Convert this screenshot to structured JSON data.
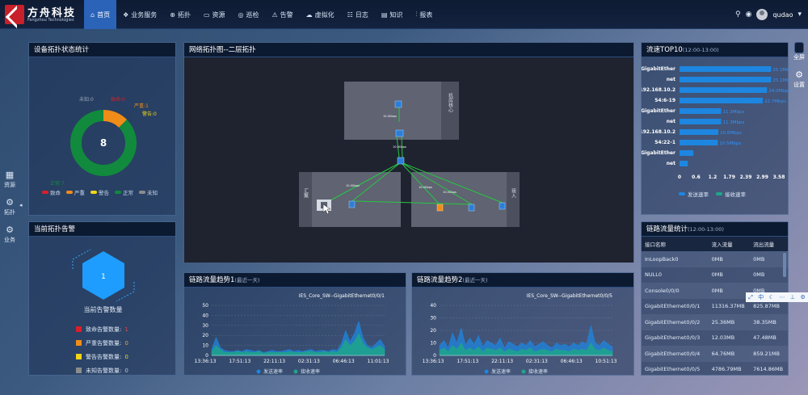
{
  "brand": {
    "name_cn": "方舟科技",
    "name_en": "Fangzhou Technologies"
  },
  "nav": [
    {
      "label": "首页",
      "icon": "home-icon",
      "glyph": "⌂"
    },
    {
      "label": "业务服务",
      "icon": "cubes-icon",
      "glyph": "❖"
    },
    {
      "label": "拓扑",
      "icon": "globe-icon",
      "glyph": "⊕"
    },
    {
      "label": "资源",
      "icon": "monitor-icon",
      "glyph": "▭"
    },
    {
      "label": "巡检",
      "icon": "inspect-icon",
      "glyph": "◎"
    },
    {
      "label": "告警",
      "icon": "alarm-icon",
      "glyph": "⚠"
    },
    {
      "label": "虚拟化",
      "icon": "cloud-icon",
      "glyph": "☁"
    },
    {
      "label": "日志",
      "icon": "log-icon",
      "glyph": "☷"
    },
    {
      "label": "知识",
      "icon": "book-icon",
      "glyph": "▤"
    },
    {
      "label": "报表",
      "icon": "chart-icon",
      "glyph": "⫶"
    }
  ],
  "user": {
    "name": "qudao"
  },
  "left_rail": [
    {
      "label": "资源",
      "glyph": "▦"
    },
    {
      "label": "拓扑",
      "glyph": "⚙"
    },
    {
      "label": "业务",
      "glyph": "⚙"
    }
  ],
  "right_rail": [
    {
      "label": "全屏"
    },
    {
      "label": "设置",
      "glyph": "⚙"
    }
  ],
  "device_status": {
    "title": "设备拓扑状态统计",
    "center_value": "8",
    "labels": {
      "unknown": "未知:0",
      "critical": "致命:0",
      "severe": "严重:1",
      "warning": "警告:0",
      "normal": "正常:7"
    },
    "legend": [
      {
        "label": "致命",
        "color": "#d8202a"
      },
      {
        "label": "严重",
        "color": "#f08c18"
      },
      {
        "label": "警告",
        "color": "#f2d418"
      },
      {
        "label": "正常",
        "color": "#118a3d"
      },
      {
        "label": "未知",
        "color": "#8c8c8c"
      }
    ],
    "counts": {
      "critical": 0,
      "severe": 1,
      "warning": 0,
      "normal": 7,
      "unknown": 0
    }
  },
  "current_alarms": {
    "title": "当前拓扑告警",
    "total": "1",
    "caption": "当前告警数量",
    "items": [
      {
        "label": "致命告警数量:",
        "value": "1",
        "color": "#d8202a",
        "value_color": "#e24a4a"
      },
      {
        "label": "严重告警数量:",
        "value": "0",
        "color": "#f08c18",
        "value_color": "#f0a03a"
      },
      {
        "label": "警告告警数量:",
        "value": "0",
        "color": "#f2d418",
        "value_color": "#f2d418"
      },
      {
        "label": "未知告警数量:",
        "value": "0",
        "color": "#8c8c8c",
        "value_color": "#c0c6cf"
      }
    ]
  },
  "topology": {
    "title": "网络拓扑图--二层拓扑",
    "groups": [
      {
        "label": "机房核心"
      },
      {
        "label": "汇聚"
      },
      {
        "label": "接入"
      }
    ]
  },
  "top10": {
    "title": "流速TOP10",
    "subtitle": "(12:00-13:00)",
    "rows": [
      {
        "label": "GigabitEther",
        "value_label": "25.1Mb"
      },
      {
        "label": "net",
        "value_label": "25.1Mb"
      },
      {
        "label": "192.168.10.2",
        "value_label": "24.0Mbps"
      },
      {
        "label": "54:6-19",
        "value_label": "22.7Mbps"
      },
      {
        "label": "GigabitEther",
        "value_label": "11.3Mbps"
      },
      {
        "label": "net",
        "value_label": "11.3Mbps"
      },
      {
        "label": "192.168.10.2",
        "value_label": "10.6Mbps"
      },
      {
        "label": "54:22-1",
        "value_label": "10.5Mbps"
      },
      {
        "label": "GigabitEther",
        "value_label": ""
      },
      {
        "label": "net",
        "value_label": ""
      }
    ],
    "bar_values": [
      3.3,
      3.3,
      3.15,
      3.0,
      1.5,
      1.5,
      1.4,
      1.38,
      0.5,
      0.3
    ],
    "axis_ticks": [
      "0",
      "0.6",
      "1.2",
      "1.79",
      "2.39",
      "2.99",
      "3.58"
    ],
    "legend": [
      "发送速率",
      "接收速率"
    ]
  },
  "link_stats": {
    "title": "链路流量统计",
    "subtitle": "(12:00-13:00)",
    "columns": [
      "接口名称",
      "流入流量",
      "流出流量"
    ],
    "rows": [
      [
        "InLoopBack0",
        "0MB",
        "0MB"
      ],
      [
        "NULL0",
        "0MB",
        "0MB"
      ],
      [
        "Console0/0/0",
        "0MB",
        "0MB"
      ],
      [
        "GigabitEthernet0/0/1",
        "11316.37MB",
        "825.87MB"
      ],
      [
        "GigabitEthernet0/0/2",
        "25.36MB",
        "38.35MB"
      ],
      [
        "GigabitEthernet0/0/3",
        "12.03MB",
        "47.48MB"
      ],
      [
        "GigabitEthernet0/0/4",
        "64.76MB",
        "859.21MB"
      ],
      [
        "GigabitEthernet0/0/5",
        "4786.79MB",
        "7614.86MB"
      ]
    ]
  },
  "float_tools": [
    "⤢",
    "中",
    "☾",
    "⋯",
    "⊥",
    "⚙"
  ],
  "trend1": {
    "title": "链路流量趋势1",
    "subtitle": "(最近一天)",
    "series_title": "IES_Core_SW--GigabitEthernet0/0/1",
    "yticks": [
      "50",
      "40",
      "30",
      "20",
      "10",
      "0"
    ],
    "xticks": [
      "13:36:13",
      "17:51:13",
      "22:11:13",
      "02:31:13",
      "06:46:13",
      "11:01:13"
    ],
    "legend": [
      "发送速率",
      "接收速率"
    ]
  },
  "trend2": {
    "title": "链路流量趋势2",
    "subtitle": "(最近一天)",
    "series_title": "IES_Core_SW--GigabitEthernet0/0/5",
    "yticks": [
      "40",
      "30",
      "20",
      "10",
      "0"
    ],
    "xticks": [
      "13:36:13",
      "17:51:13",
      "22:11:13",
      "02:31:13",
      "06:46:13",
      "10:51:13"
    ],
    "legend": [
      "发送速率",
      "接收速率"
    ]
  },
  "chart_data": [
    {
      "type": "pie",
      "title": "设备拓扑状态统计",
      "categories": [
        "致命",
        "严重",
        "警告",
        "正常",
        "未知"
      ],
      "values": [
        0,
        1,
        0,
        7,
        0
      ]
    },
    {
      "type": "bar",
      "title": "流速TOP10",
      "categories": [
        "GigabitEther",
        "net",
        "192.168.10.2",
        "54:6-19",
        "GigabitEther",
        "net",
        "192.168.10.2",
        "54:22-1",
        "GigabitEther",
        "net"
      ],
      "values": [
        3.3,
        3.3,
        3.15,
        3.0,
        1.5,
        1.5,
        1.4,
        1.38,
        0.5,
        0.3
      ],
      "xlim": [
        0,
        3.58
      ]
    },
    {
      "type": "area",
      "title": "链路流量趋势1",
      "ylim": [
        0,
        50
      ],
      "x": [
        "13:36:13",
        "17:51:13",
        "22:11:13",
        "02:31:13",
        "06:46:13",
        "11:01:13"
      ],
      "series": [
        {
          "name": "发送速率",
          "values": [
            6,
            18,
            8,
            5,
            4,
            4,
            5,
            4,
            6,
            5,
            4,
            5,
            3,
            4,
            5,
            4,
            4,
            5,
            6,
            4,
            5,
            4,
            5,
            6,
            4,
            5,
            5,
            4,
            6,
            5,
            12,
            25,
            14,
            22,
            34,
            18,
            10,
            8,
            12,
            16,
            9
          ]
        },
        {
          "name": "接收速率",
          "values": [
            4,
            10,
            6,
            3,
            3,
            3,
            4,
            3,
            4,
            3,
            3,
            4,
            2,
            3,
            3,
            3,
            3,
            3,
            4,
            3,
            3,
            3,
            4,
            4,
            3,
            3,
            4,
            3,
            4,
            3,
            8,
            16,
            10,
            14,
            22,
            12,
            8,
            6,
            8,
            10,
            6
          ]
        }
      ]
    },
    {
      "type": "area",
      "title": "链路流量趋势2",
      "ylim": [
        0,
        40
      ],
      "x": [
        "13:36:13",
        "17:51:13",
        "22:11:13",
        "02:31:13",
        "06:46:13",
        "10:51:13"
      ],
      "series": [
        {
          "name": "发送速率",
          "values": [
            8,
            12,
            6,
            18,
            10,
            22,
            8,
            14,
            9,
            16,
            7,
            12,
            10,
            8,
            14,
            6,
            11,
            9,
            7,
            10,
            8,
            12,
            7,
            9,
            11,
            8,
            6,
            10,
            8,
            9,
            7,
            10,
            8,
            11,
            9,
            24,
            10,
            8,
            12,
            9,
            7
          ]
        },
        {
          "name": "接收速率",
          "values": [
            4,
            6,
            3,
            8,
            5,
            10,
            4,
            6,
            4,
            7,
            3,
            6,
            5,
            4,
            6,
            3,
            5,
            4,
            3,
            5,
            4,
            6,
            3,
            4,
            5,
            4,
            3,
            5,
            4,
            4,
            3,
            5,
            4,
            5,
            4,
            10,
            5,
            4,
            6,
            4,
            3
          ]
        }
      ]
    }
  ]
}
